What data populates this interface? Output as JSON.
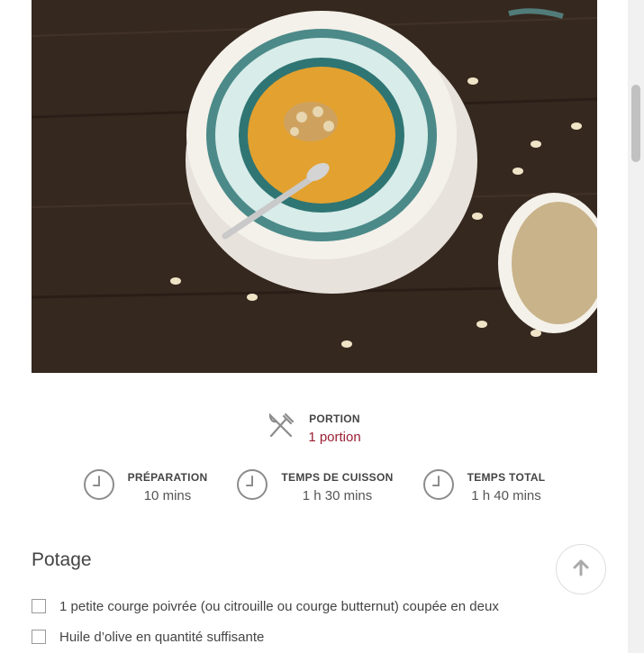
{
  "recipe": {
    "portion": {
      "label": "PORTION",
      "value": "1 portion",
      "icon": "fork-knife-icon"
    },
    "times": [
      {
        "label": "PRÉPARATION",
        "value": "10 mins",
        "icon": "clock-icon"
      },
      {
        "label": "TEMPS DE CUISSON",
        "value": "1 h 30 mins",
        "icon": "clock-icon"
      },
      {
        "label": "TEMPS TOTAL",
        "value": "1 h 40 mins",
        "icon": "clock-icon"
      }
    ],
    "section_title": "Potage",
    "ingredients": [
      "1 petite courge poivrée (ou citrouille ou courge butternut) coupée en deux",
      "Huile d’olive en quantité suffisante"
    ]
  },
  "controls": {
    "back_to_top_icon": "arrow-up-icon"
  },
  "colors": {
    "accent": "#9b1f33",
    "text": "#444444"
  }
}
